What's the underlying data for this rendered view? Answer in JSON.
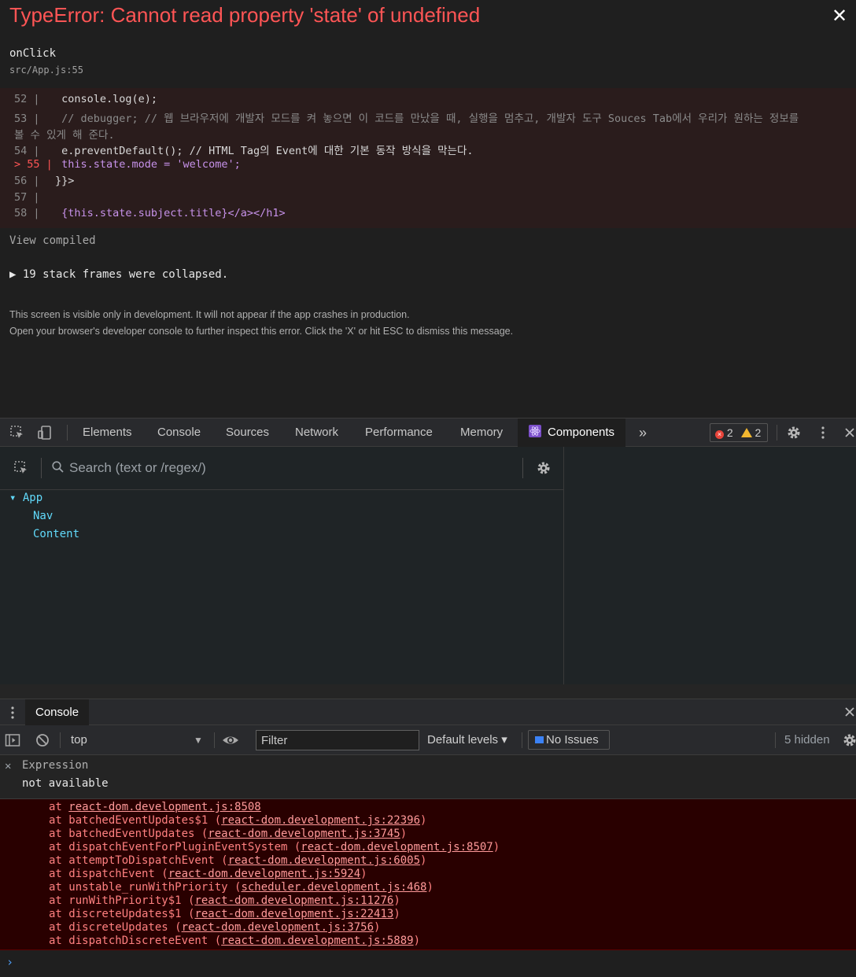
{
  "overlay": {
    "title": "TypeError: Cannot read property 'state' of undefined",
    "function_name": "onClick",
    "file_location": "src/App.js:55",
    "code_lines": [
      {
        "num": "52 |",
        "code": "    console.log(e);"
      },
      {
        "num": "53 |",
        "code": "    // debugger;   // 웹 브라우저에 개발자 모드를 켜 놓으면 이 코드를 만났을 때, 실행을 멈추고, 개발자 도구 Souces Tab에서 우리가 원하는 정보를"
      },
      {
        "num": "",
        "code": "볼 수 있게 해 준다."
      },
      {
        "num": "54 |",
        "code": "    e.preventDefault(); // HTML Tag의 Event에 대한 기본 동작 방식을 막는다."
      },
      {
        "num": "> 55 |",
        "code": "    this.state.mode = 'welcome';"
      },
      {
        "num": "56 |",
        "code": "}}>"
      },
      {
        "num": "57 |",
        "code": ""
      },
      {
        "num": "58 |",
        "code": "    {this.state.subject.title}</a></h1>"
      }
    ],
    "view_compiled": "View compiled",
    "stack_collapsed": "▶ 19 stack frames were collapsed.",
    "note_line1": "This screen is visible only in development. It will not appear if the app crashes in production.",
    "note_line2": "Open your browser's developer console to further inspect this error.  Click the 'X' or hit ESC to dismiss this message.",
    "close_glyph": "✕"
  },
  "devtools": {
    "tabs": [
      "Elements",
      "Console",
      "Sources",
      "Network",
      "Performance",
      "Memory"
    ],
    "active_tab": "Components",
    "more_glyph": "»",
    "error_count": "2",
    "warning_count": "2"
  },
  "components": {
    "search_placeholder": "Search (text or /regex/)",
    "tree": [
      {
        "label": "▾ App"
      },
      {
        "label": "Nav"
      },
      {
        "label": "Content"
      }
    ]
  },
  "console": {
    "drawer_tab": "Console",
    "context": "top",
    "filter_placeholder": "Filter",
    "levels": "Default levels ▾",
    "issues": "No Issues",
    "hidden": "5 hidden",
    "expression_label": "Expression",
    "expression_value": "not available",
    "stack_frames": [
      {
        "fn": "at ",
        "loc": "react-dom.development.js:8508",
        "tail": ""
      },
      {
        "fn": "at batchedEventUpdates$1 (",
        "loc": "react-dom.development.js:22396",
        "tail": ")"
      },
      {
        "fn": "at batchedEventUpdates (",
        "loc": "react-dom.development.js:3745",
        "tail": ")"
      },
      {
        "fn": "at dispatchEventForPluginEventSystem (",
        "loc": "react-dom.development.js:8507",
        "tail": ")"
      },
      {
        "fn": "at attemptToDispatchEvent (",
        "loc": "react-dom.development.js:6005",
        "tail": ")"
      },
      {
        "fn": "at dispatchEvent (",
        "loc": "react-dom.development.js:5924",
        "tail": ")"
      },
      {
        "fn": "at unstable_runWithPriority (",
        "loc": "scheduler.development.js:468",
        "tail": ")"
      },
      {
        "fn": "at runWithPriority$1 (",
        "loc": "react-dom.development.js:11276",
        "tail": ")"
      },
      {
        "fn": "at discreteUpdates$1 (",
        "loc": "react-dom.development.js:22413",
        "tail": ")"
      },
      {
        "fn": "at discreteUpdates (",
        "loc": "react-dom.development.js:3756",
        "tail": ")"
      },
      {
        "fn": "at dispatchDiscreteEvent (",
        "loc": "react-dom.development.js:5889",
        "tail": ")"
      }
    ],
    "prompt": "›"
  }
}
